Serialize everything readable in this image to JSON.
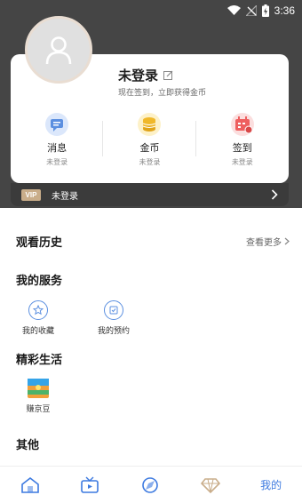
{
  "status_bar": {
    "time": "3:36"
  },
  "profile": {
    "username": "未登录",
    "subtitle": "现在签到，立即获得金币"
  },
  "stats": [
    {
      "label": "消息",
      "sub": "未登录"
    },
    {
      "label": "金币",
      "sub": "未登录"
    },
    {
      "label": "签到",
      "sub": "未登录"
    }
  ],
  "vip": {
    "badge": "VIP",
    "text": "未登录"
  },
  "sections": {
    "history": {
      "title": "观看历史",
      "more": "查看更多"
    },
    "services": {
      "title": "我的服务",
      "items": [
        {
          "label": "我的收藏"
        },
        {
          "label": "我的预约"
        }
      ]
    },
    "life": {
      "title": "精彩生活",
      "items": [
        {
          "label": "赚京豆"
        }
      ]
    },
    "other": {
      "title": "其他"
    }
  },
  "bottom_nav": {
    "icons": [
      "home-icon",
      "tv-icon",
      "explore-icon",
      "vip-diamond-icon"
    ],
    "active_label": "我的"
  },
  "colors": {
    "accent": "#3d7ae0",
    "header": "#454545",
    "gold": "#c9ad8a"
  }
}
